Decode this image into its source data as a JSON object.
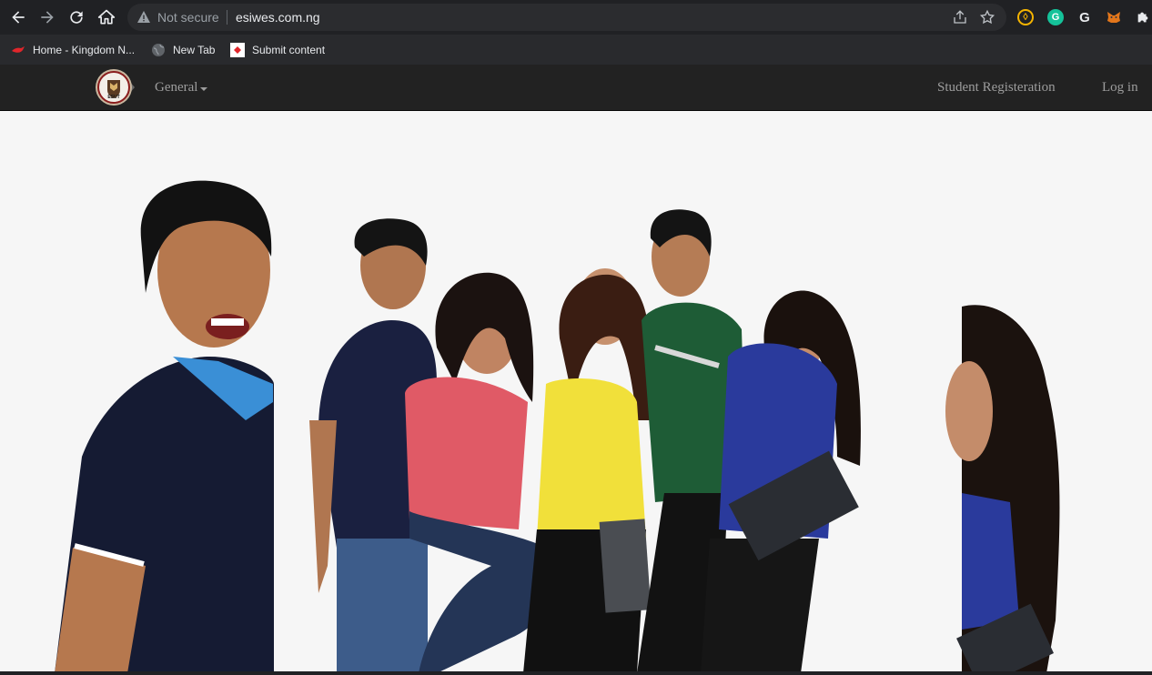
{
  "browser": {
    "security_label": "Not secure",
    "url": "esiwes.com.ng",
    "bookmarks": [
      {
        "label": "Home - Kingdom N...",
        "icon": "bird-icon"
      },
      {
        "label": "New Tab",
        "icon": "globe-icon"
      },
      {
        "label": "Submit content",
        "icon": "submit-icon"
      }
    ],
    "extensions": [
      "coin-extension-icon",
      "grammarly-icon",
      "google-icon",
      "metamask-icon",
      "puzzle-icon"
    ]
  },
  "site": {
    "logo_text": "ESUT",
    "nav": {
      "general_label": "General",
      "register_label": "Student Registeration",
      "login_label": "Log in"
    }
  },
  "colors": {
    "navbar": "#222222",
    "nav_text": "#9d9d9d",
    "chrome": "#202124"
  }
}
